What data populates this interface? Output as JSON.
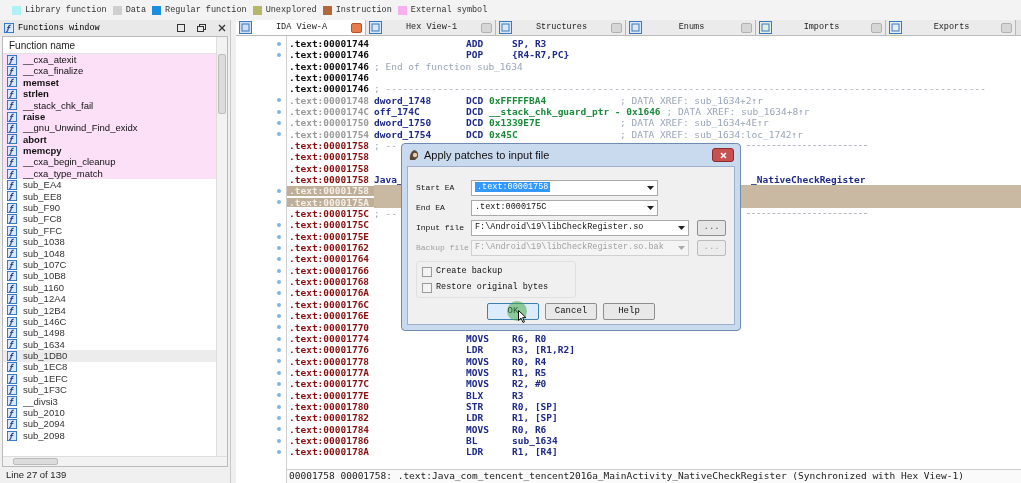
{
  "legend": [
    {
      "label": "Library function",
      "color": "#aef2f4"
    },
    {
      "label": "Data",
      "color": "#cfcfcf"
    },
    {
      "label": "Regular function",
      "color": "#1a8fe0"
    },
    {
      "label": "Unexplored",
      "color": "#b7b76c"
    },
    {
      "label": "Instruction",
      "color": "#b3683c"
    },
    {
      "label": "External symbol",
      "color": "#f7b0ef"
    }
  ],
  "functions_window": {
    "title": "Functions window",
    "column": "Function name",
    "status": "Line 27 of 139",
    "items": [
      {
        "name": "__cxa_atexit",
        "kind": "external",
        "bold": false,
        "selected": false
      },
      {
        "name": "__cxa_finalize",
        "kind": "external",
        "bold": false,
        "selected": false
      },
      {
        "name": "memset",
        "kind": "external",
        "bold": true,
        "selected": false
      },
      {
        "name": "strlen",
        "kind": "external",
        "bold": true,
        "selected": false
      },
      {
        "name": "__stack_chk_fail",
        "kind": "external",
        "bold": false,
        "selected": false
      },
      {
        "name": "raise",
        "kind": "external",
        "bold": true,
        "selected": false
      },
      {
        "name": "__gnu_Unwind_Find_exidx",
        "kind": "external",
        "bold": false,
        "selected": false
      },
      {
        "name": "abort",
        "kind": "external",
        "bold": true,
        "selected": false
      },
      {
        "name": "memcpy",
        "kind": "external",
        "bold": true,
        "selected": false
      },
      {
        "name": "__cxa_begin_cleanup",
        "kind": "external",
        "bold": false,
        "selected": false
      },
      {
        "name": "__cxa_type_match",
        "kind": "external",
        "bold": false,
        "selected": false
      },
      {
        "name": "sub_EA4",
        "kind": "regular",
        "bold": false,
        "selected": false
      },
      {
        "name": "sub_EE8",
        "kind": "regular",
        "bold": false,
        "selected": false
      },
      {
        "name": "sub_F90",
        "kind": "regular",
        "bold": false,
        "selected": false
      },
      {
        "name": "sub_FC8",
        "kind": "regular",
        "bold": false,
        "selected": false
      },
      {
        "name": "sub_FFC",
        "kind": "regular",
        "bold": false,
        "selected": false
      },
      {
        "name": "sub_1038",
        "kind": "regular",
        "bold": false,
        "selected": false
      },
      {
        "name": "sub_1048",
        "kind": "regular",
        "bold": false,
        "selected": false
      },
      {
        "name": "sub_107C",
        "kind": "regular",
        "bold": false,
        "selected": false
      },
      {
        "name": "sub_10B8",
        "kind": "regular",
        "bold": false,
        "selected": false
      },
      {
        "name": "sub_1160",
        "kind": "regular",
        "bold": false,
        "selected": false
      },
      {
        "name": "sub_12A4",
        "kind": "regular",
        "bold": false,
        "selected": false
      },
      {
        "name": "sub_12B4",
        "kind": "regular",
        "bold": false,
        "selected": false
      },
      {
        "name": "sub_146C",
        "kind": "regular",
        "bold": false,
        "selected": false
      },
      {
        "name": "sub_1498",
        "kind": "regular",
        "bold": false,
        "selected": false
      },
      {
        "name": "sub_1634",
        "kind": "regular",
        "bold": false,
        "selected": false
      },
      {
        "name": "sub_1DB0",
        "kind": "regular",
        "bold": false,
        "selected": true
      },
      {
        "name": "sub_1EC8",
        "kind": "regular",
        "bold": false,
        "selected": false
      },
      {
        "name": "sub_1EFC",
        "kind": "regular",
        "bold": false,
        "selected": false
      },
      {
        "name": "sub_1F3C",
        "kind": "regular",
        "bold": false,
        "selected": false
      },
      {
        "name": "__divsi3",
        "kind": "regular",
        "bold": false,
        "selected": false
      },
      {
        "name": "sub_2010",
        "kind": "regular",
        "bold": false,
        "selected": false
      },
      {
        "name": "sub_2094",
        "kind": "regular",
        "bold": false,
        "selected": false
      },
      {
        "name": "sub_2098",
        "kind": "regular",
        "bold": false,
        "selected": false
      }
    ]
  },
  "tabs": [
    {
      "label": "IDA View-A",
      "selected": true
    },
    {
      "label": "Hex View-1",
      "selected": false
    },
    {
      "label": "Structures",
      "selected": false
    },
    {
      "label": "Enums",
      "selected": false
    },
    {
      "label": "Imports",
      "selected": false
    },
    {
      "label": "Exports",
      "selected": false
    }
  ],
  "listing": [
    {
      "address": ".text:00001744",
      "kind": "code",
      "dot": true,
      "selected": false,
      "op": "ADD",
      "args": "SP, R3"
    },
    {
      "address": ".text:00001746",
      "kind": "code",
      "dot": true,
      "selected": false,
      "op": "POP",
      "args": "{R4-R7,PC}"
    },
    {
      "address": ".text:00001746",
      "kind": "code",
      "dot": false,
      "selected": false,
      "comment": "; End of function sub_1634"
    },
    {
      "address": ".text:00001746",
      "kind": "code",
      "dot": false,
      "selected": false
    },
    {
      "address": ".text:00001746",
      "kind": "code",
      "dot": false,
      "selected": false,
      "comment": "; ---------------------------------------------------------------------------------------------------------"
    },
    {
      "address": ".text:00001748",
      "kind": "data",
      "dot": true,
      "selected": false,
      "label": "dword_1748",
      "op": "DCD",
      "args": "0xFFFFFBA4",
      "comment": "; DATA XREF: sub_1634+2↑r"
    },
    {
      "address": ".text:0000174C",
      "kind": "data",
      "dot": true,
      "selected": false,
      "label": "off_174C",
      "op": "DCD",
      "args": "__stack_chk_guard_ptr - 0x1646",
      "comment": "; DATA XREF: sub_1634+8↑r"
    },
    {
      "address": ".text:00001750",
      "kind": "data",
      "dot": true,
      "selected": false,
      "label": "dword_1750",
      "op": "DCD",
      "args": "0x1339E7E",
      "comment": "; DATA XREF: sub_1634+4E↑r"
    },
    {
      "address": ".text:00001754",
      "kind": "data",
      "dot": true,
      "selected": false,
      "label": "dword_1754",
      "op": "DCD",
      "args": "0x45C",
      "comment": "; DATA XREF: sub_1634:loc_1742↑r"
    },
    {
      "address": ".text:00001758",
      "kind": "func",
      "dot": false,
      "selected": false,
      "comment": "; --",
      "rule": true
    },
    {
      "address": ".text:00001758",
      "kind": "func",
      "dot": false,
      "selected": false
    },
    {
      "address": ".text:00001758",
      "kind": "func",
      "dot": false,
      "selected": false
    },
    {
      "address": ".text:00001758",
      "kind": "func",
      "dot": false,
      "selected": false,
      "label": "Java_",
      "tail": "_NativeCheckRegister"
    },
    {
      "address": ".text:00001758",
      "kind": "func",
      "dot": true,
      "selected": true
    },
    {
      "address": ".text:0000175A",
      "kind": "func",
      "dot": true,
      "selected": true
    },
    {
      "address": ".text:0000175C",
      "kind": "func",
      "dot": false,
      "selected": false,
      "comment": "; --",
      "rule": true
    },
    {
      "address": ".text:0000175C",
      "kind": "func",
      "dot": true,
      "selected": false
    },
    {
      "address": ".text:0000175E",
      "kind": "func",
      "dot": true,
      "selected": false
    },
    {
      "address": ".text:00001762",
      "kind": "func",
      "dot": true,
      "selected": false
    },
    {
      "address": ".text:00001764",
      "kind": "func",
      "dot": true,
      "selected": false
    },
    {
      "address": ".text:00001766",
      "kind": "func",
      "dot": true,
      "selected": false
    },
    {
      "address": ".text:00001768",
      "kind": "func",
      "dot": true,
      "selected": false
    },
    {
      "address": ".text:0000176A",
      "kind": "func",
      "dot": true,
      "selected": false
    },
    {
      "address": ".text:0000176C",
      "kind": "func",
      "dot": true,
      "selected": false
    },
    {
      "address": ".text:0000176E",
      "kind": "func",
      "dot": true,
      "selected": false
    },
    {
      "address": ".text:00001770",
      "kind": "func",
      "dot": true,
      "selected": false
    },
    {
      "address": ".text:00001774",
      "kind": "func",
      "dot": true,
      "selected": false,
      "op": "MOVS",
      "args": "R6, R0"
    },
    {
      "address": ".text:00001776",
      "kind": "func",
      "dot": true,
      "selected": false,
      "op": "LDR",
      "args": "R3, [R1,R2]"
    },
    {
      "address": ".text:00001778",
      "kind": "func",
      "dot": true,
      "selected": false,
      "op": "MOVS",
      "args": "R0, R4"
    },
    {
      "address": ".text:0000177A",
      "kind": "func",
      "dot": true,
      "selected": false,
      "op": "MOVS",
      "args": "R1, R5"
    },
    {
      "address": ".text:0000177C",
      "kind": "func",
      "dot": true,
      "selected": false,
      "op": "MOVS",
      "args": "R2, #0"
    },
    {
      "address": ".text:0000177E",
      "kind": "func",
      "dot": true,
      "selected": false,
      "op": "BLX",
      "args": "R3"
    },
    {
      "address": ".text:00001780",
      "kind": "func",
      "dot": true,
      "selected": false,
      "op": "STR",
      "args": "R0, [SP]"
    },
    {
      "address": ".text:00001782",
      "kind": "func",
      "dot": true,
      "selected": false,
      "op": "LDR",
      "args": "R1, [SP]"
    },
    {
      "address": ".text:00001784",
      "kind": "func",
      "dot": true,
      "selected": false,
      "op": "MOVS",
      "args": "R0, R6"
    },
    {
      "address": ".text:00001786",
      "kind": "func",
      "dot": true,
      "selected": false,
      "op": "BL",
      "args": "sub_1634"
    },
    {
      "address": ".text:0000178A",
      "kind": "func",
      "dot": true,
      "selected": false,
      "op": "LDR",
      "args": "R1, [R4]"
    }
  ],
  "status_line": "00001758 00001758: .text:Java_com_tencent_tencent2016a_MainActivity_NativeCheckRegister (Synchronized with Hex View-1)",
  "dialog": {
    "title": "Apply patches to input file",
    "fields": [
      {
        "label": "Start EA",
        "value": ".text:00001758",
        "kind": "combo",
        "disabled": false,
        "selected": true
      },
      {
        "label": "End EA",
        "value": ".text:0000175C",
        "kind": "combo",
        "disabled": false,
        "selected": false
      },
      {
        "label": "Input file",
        "value": "F:\\Android\\19\\libCheckRegister.so",
        "kind": "file",
        "disabled": false,
        "selected": false,
        "browse": "..."
      },
      {
        "label": "Backup file",
        "value": "F:\\Android\\19\\libCheckRegister.so.bak",
        "kind": "file",
        "disabled": true,
        "selected": false,
        "browse": "..."
      }
    ],
    "checkboxes": [
      {
        "label": "Create backup",
        "checked": false
      },
      {
        "label": "Restore original bytes",
        "checked": false
      }
    ],
    "buttons": [
      {
        "label": "OK",
        "default": true
      },
      {
        "label": "Cancel",
        "default": false
      },
      {
        "label": "Help",
        "default": false
      }
    ]
  }
}
